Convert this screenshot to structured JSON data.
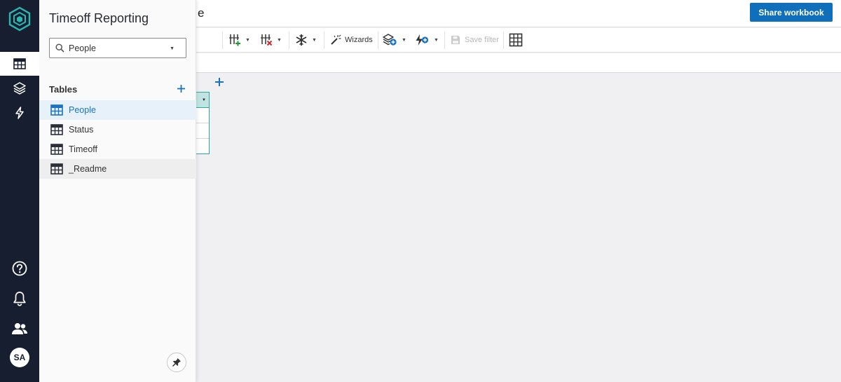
{
  "app": {
    "panel_title": "Timeoff Reporting",
    "doc_title_tail": "e",
    "accent": "#0f6fba"
  },
  "header": {
    "share_label": "Share workbook"
  },
  "toolbar": {
    "wizards_label": "Wizards",
    "save_filter_label": "Save filter"
  },
  "panel": {
    "search_value": "People",
    "tables_heading": "Tables",
    "tables": [
      {
        "label": "People",
        "state": "selected"
      },
      {
        "label": "Status",
        "state": "normal"
      },
      {
        "label": "Timeoff",
        "state": "normal"
      },
      {
        "label": "_Readme",
        "state": "hover"
      }
    ]
  },
  "rail": {
    "icons": [
      "logo-icon",
      "table-icon",
      "layers-icon",
      "lightning-icon",
      "help-icon",
      "bell-icon",
      "users-icon"
    ],
    "avatar_initials": "SA"
  }
}
